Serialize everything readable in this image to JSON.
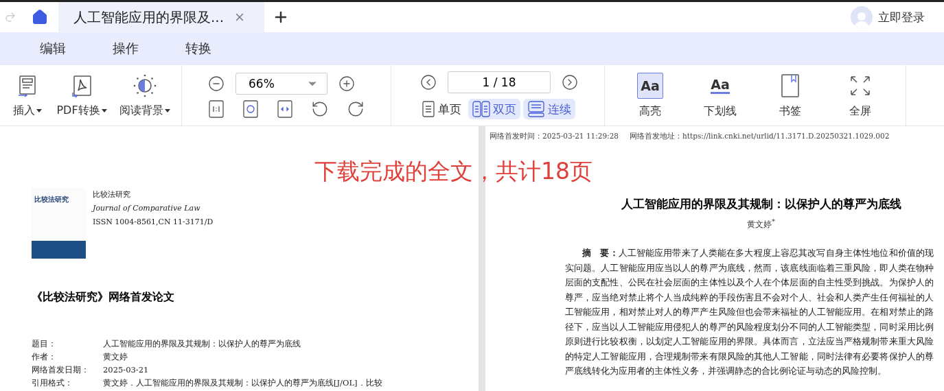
{
  "top_bar": {
    "tab": {
      "title": "人工智能应用的界限及...",
      "selected": true
    },
    "login": "立即登录"
  },
  "menu": [
    {
      "label": "编辑"
    },
    {
      "label": "操作"
    },
    {
      "label": "转换"
    }
  ],
  "toolbar": {
    "insert_tools": [
      {
        "label": "插入",
        "kind": "insert"
      },
      {
        "label": "PDF转换",
        "kind": "pdf"
      },
      {
        "label": "阅读背景",
        "kind": "background"
      }
    ],
    "zoom": {
      "value": "66%"
    },
    "page": {
      "value": "1 / 18"
    },
    "view_modes": [
      {
        "label": "单页",
        "kind": "single",
        "selected": false
      },
      {
        "label": "双页",
        "kind": "double",
        "selected": true
      },
      {
        "label": "连续",
        "kind": "continuous",
        "selected": true
      }
    ],
    "markup_tools": [
      {
        "label": "高亮",
        "kind": "highlight",
        "icon_text": "Aa",
        "selected": true
      },
      {
        "label": "下划线",
        "kind": "underline",
        "icon_text": "Aa",
        "selected": false
      },
      {
        "label": "书签",
        "kind": "bookmark",
        "selected": false
      },
      {
        "label": "全屏",
        "kind": "fullscreen",
        "selected": false
      }
    ]
  },
  "annotation": "下载完成的全文，共计18页",
  "left_page": {
    "cover_title": "比较法研究",
    "journal_cn": "比较法研究",
    "journal_en": "Journal of Comparative Law",
    "issn": "ISSN 1004-8561,CN 11-3171/D",
    "heading": "《比较法研究》网络首发论文",
    "fields": [
      {
        "label": "题目：",
        "value": "人工智能应用的界限及其规制：以保护人的尊严为底线"
      },
      {
        "label": "作者：",
        "value": "黄文婷"
      },
      {
        "label": "网络首发日期：",
        "value": "2025-03-21"
      },
      {
        "label": "引用格式：",
        "value": "黄文婷．人工智能应用的界限及其规制：以保护人的尊严为底线[J/OL]．比较"
      }
    ]
  },
  "right_page": {
    "header_time": "网络首发时间：2025-03-21 11:29:28",
    "header_url": "网络首发地址：https://link.cnki.net/urlid/11.3171.D.20250321.1029.002",
    "title": "人工智能应用的界限及其规制：以保护人的尊严为底线",
    "author": "黄文婷$^{*}$",
    "abstract": "**摘　要：**人工智能应用带来了人类能在多大程度上容忍其改写自身主体性地位和价值的现实问题。人工智能应用应当以人的尊严为底线，然而，该底线面临着三重风险，即人类在物种层面的支配性、公民在社会层面的主体性以及个人在个体层面的自主性受到挑战。为保护人的尊严，应当绝对禁止将个人当成纯粹的手段伤害且不会对个人、社会和人类产生任何福祉的人工智能应用，相对禁止对人的尊严产生风险但也会带来福祉的人工智能应用。在相对禁止的路径下，应当以人工智能应用侵犯人的尊严的风险程度划分不同的人工智能类型，同时采用比例原则进行比较权衡，以划定人工智能应用的界限。具体而言，立法应当严格规制带来重大风险的特定人工智能应用，合理规制带来有限风险的其他人工智能，同时法律有必要将保护人的尊严底线转化为应用者的主体性义务，并强调静态的合比例论证与动态的风险控制。"
  }
}
